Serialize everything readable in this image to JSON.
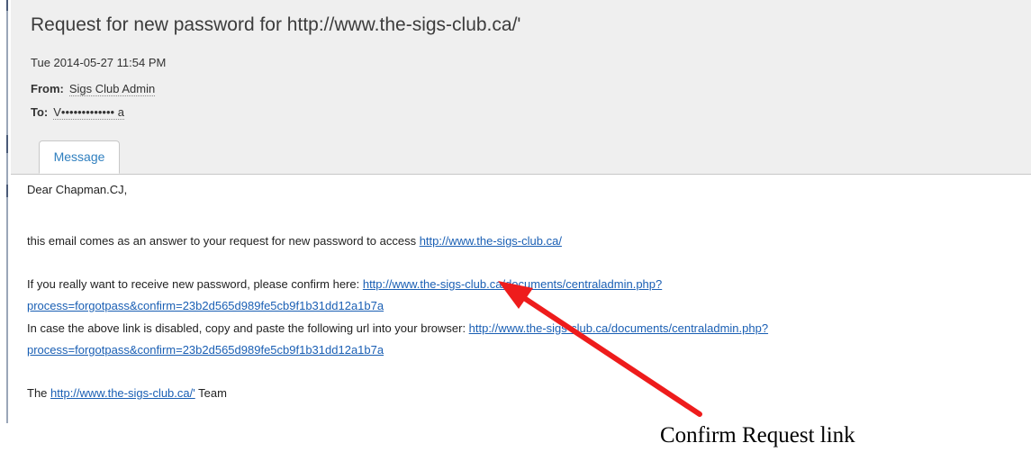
{
  "email": {
    "subject": "Request for new password for http://www.the-sigs-club.ca/'",
    "date": "Tue 2014-05-27 11:54 PM",
    "from_label": "From:",
    "from_value": "Sigs Club Admin",
    "to_label": "To:",
    "to_value": "V••••••••••••• a",
    "tab_label": "Message"
  },
  "message": {
    "greeting": "Dear Chapman.CJ,",
    "line1_text": "this email comes as an answer to your request for new password to access ",
    "line1_link": "http://www.the-sigs-club.ca/",
    "line2_text": "If you really want to receive new password, please confirm here: ",
    "line2_link_a": "http://www.the-sigs-club.ca/documents/centraladmin.php?",
    "line2_link_b": "process=forgotpass&confirm=23b2d565d989fe5cb9f1b31dd12a1b7a",
    "line3_text": "In case the above link is disabled, copy and paste the following url into your browser: ",
    "line3_link_a": "http://www.the-sigs-club.ca/documents/centraladmin.php?",
    "line3_link_b": "process=forgotpass&confirm=23b2d565d989fe5cb9f1b31dd12a1b7a",
    "signoff_pre": "The ",
    "signoff_link": "http://www.the-sigs-club.ca/'",
    "signoff_post": " Team"
  },
  "annotation": {
    "label": "Confirm Request link",
    "arrow_color": "#ee1c1c"
  },
  "colors": {
    "link": "#1a5fb4",
    "tab_text": "#2f7fbf",
    "header_bg": "#efefef"
  }
}
